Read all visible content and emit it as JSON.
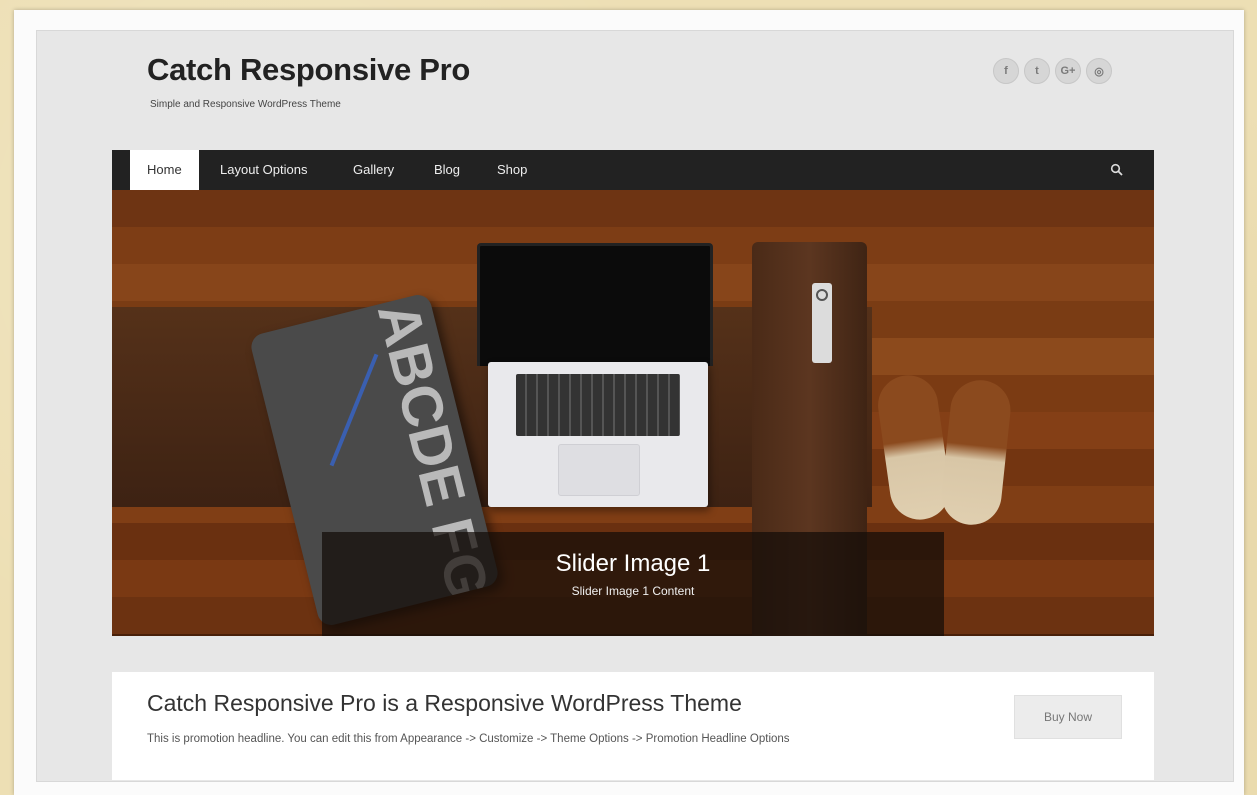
{
  "site": {
    "title": "Catch Responsive Pro",
    "tagline": "Simple and Responsive WordPress Theme"
  },
  "social": [
    {
      "icon": "facebook-icon",
      "glyph": "f"
    },
    {
      "icon": "twitter-icon",
      "glyph": "t"
    },
    {
      "icon": "google-plus-icon",
      "glyph": "G+"
    },
    {
      "icon": "dribbble-icon",
      "glyph": "◎"
    }
  ],
  "nav": {
    "items": [
      {
        "label": "Home",
        "active": true
      },
      {
        "label": "Layout Options",
        "active": false
      },
      {
        "label": "Gallery",
        "active": false
      },
      {
        "label": "Blog",
        "active": false
      },
      {
        "label": "Shop",
        "active": false
      }
    ],
    "search_icon": "search-icon"
  },
  "slider": {
    "title": "Slider Image 1",
    "content": "Slider Image 1 Content",
    "pillow_letters": "ABCDE FGHIJKL"
  },
  "promo": {
    "title": "Catch Responsive Pro is a Responsive WordPress Theme",
    "text": "This is promotion headline. You can edit this from Appearance -> Customize -> Theme Options -> Promotion Headline Options",
    "button_label": "Buy Now"
  },
  "colors": {
    "navbar": "#222222",
    "site_background": "#e7e7e7",
    "frame": "#eddfb4"
  }
}
